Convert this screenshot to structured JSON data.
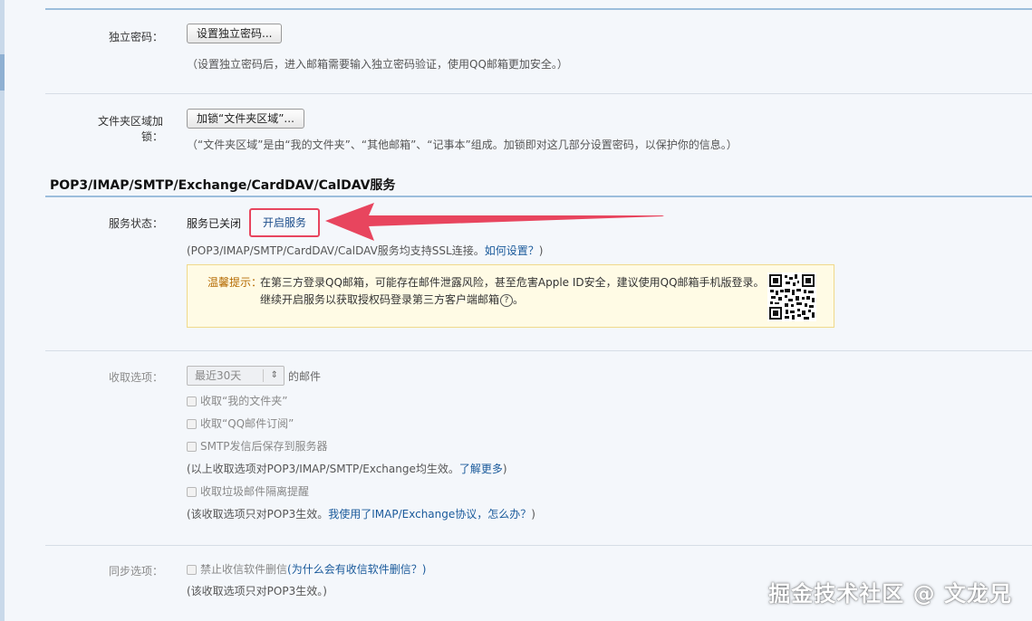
{
  "independent_password": {
    "label": "独立密码：",
    "button": "设置独立密码...",
    "hint": "（设置独立密码后，进入邮箱需要输入独立密码验证，使用QQ邮箱更加安全。）"
  },
  "folder_lock": {
    "label": "文件夹区域加锁：",
    "button": "加锁“文件夹区域”...",
    "hint": "（“文件夹区域”是由“我的文件夹”、“其他邮箱”、“记事本”组成。加锁即对这几部分设置密码，以保护你的信息。）"
  },
  "service": {
    "title": "POP3/IMAP/SMTP/Exchange/CardDAV/CalDAV服务",
    "status_label": "服务状态：",
    "status_text": "服务已关闭",
    "open_button": "开启服务",
    "ssl_hint_prefix": "(POP3/IMAP/SMTP/CardDAV/CalDAV服务均支持SSL连接。",
    "ssl_hint_link": "如何设置？",
    "ssl_hint_suffix": ")",
    "tip": {
      "label": "温馨提示：",
      "line1": "在第三方登录QQ邮箱，可能存在邮件泄露风险，甚至危害Apple ID安全，建议使用QQ邮箱手机版登录。",
      "line2": "继续开启服务以获取授权码登录第三方客户端邮箱",
      "help_icon": "question-circle-icon",
      "qr_icon": "qr-code-icon"
    },
    "annotation_color": "#e8455e"
  },
  "receive": {
    "label": "收取选项：",
    "select_value": "最近30天",
    "select_suffix": "的邮件",
    "options": [
      "收取“我的文件夹”",
      "收取“QQ邮件订阅”",
      "SMTP发信后保存到服务器"
    ],
    "hint1_prefix": "(以上收取选项对POP3/IMAP/SMTP/Exchange均生效。",
    "hint1_link": "了解更多",
    "hint1_suffix": ")",
    "spam_option": "收取垃圾邮件隔离提醒",
    "hint2_prefix": "(该收取选项只对POP3生效。",
    "hint2_link": "我使用了IMAP/Exchange协议，怎么办？",
    "hint2_suffix": ")"
  },
  "sync": {
    "label": "同步选项：",
    "option": "禁止收信软件删信",
    "option_link": "(为什么会有收信软件删信？)",
    "hint": "(该收取选项只对POP3生效。)"
  },
  "watermark": "掘金技术社区 @ 文龙兄"
}
